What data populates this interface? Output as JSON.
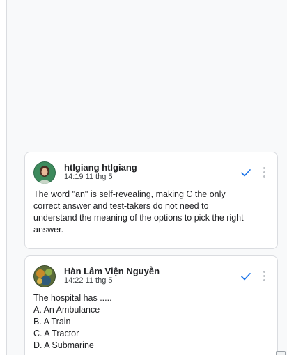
{
  "comments": [
    {
      "author": "htlgiang htlgiang",
      "time": "14:19 11 thg 5",
      "lines": [
        "The word \"an\" is self-revealing, making C the only",
        "correct answer and test-takers do not need to",
        "understand the meaning of the options to pick the right",
        "answer."
      ]
    },
    {
      "author": "Hàn Lâm Viện Nguyễn",
      "time": "14:22 11 thg 5",
      "lines": [
        "The hospital has .....",
        "A. An Ambulance",
        "B. A Train",
        "C. A Tractor",
        "D. A Submarine"
      ]
    }
  ],
  "icons": {
    "resolve": "checkmark-icon",
    "more": "more-vert-icon"
  },
  "colors": {
    "accent": "#1a73e8",
    "border": "#dadce0",
    "muted": "#bdc1c6"
  }
}
